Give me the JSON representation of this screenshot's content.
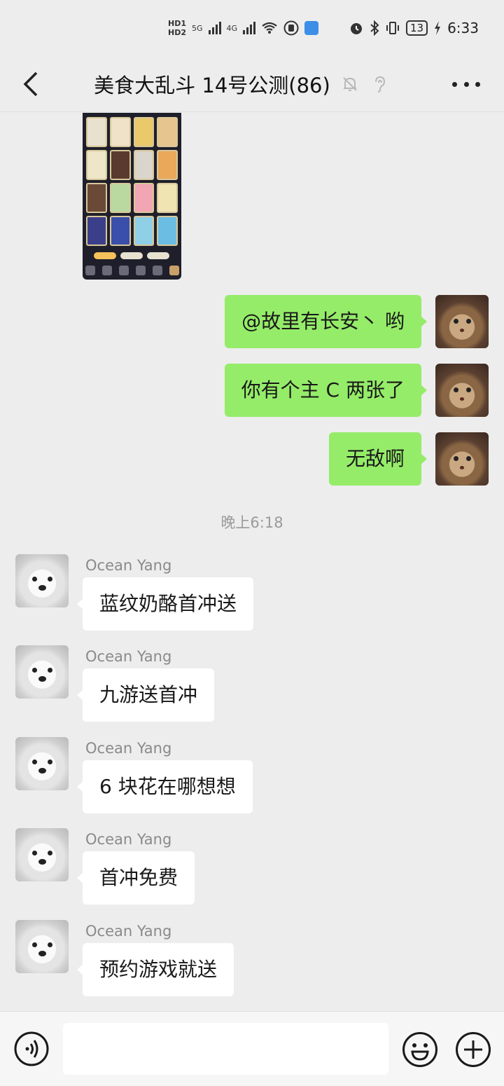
{
  "status_bar": {
    "hd1": "HD1",
    "hd2": "HD2",
    "net1": "5G",
    "net2": "4G",
    "battery": "13",
    "time": "6:33",
    "icons": [
      "wifi-icon",
      "hand-icon",
      "app-chip-icon",
      "alarm-icon",
      "bluetooth-icon",
      "vibrate-icon",
      "charging-icon"
    ]
  },
  "nav": {
    "title": "美食大乱斗 14号公测(86)",
    "icons": [
      "back-chevron-icon",
      "mute-bell-icon",
      "ear-icon",
      "more-dots-icon"
    ]
  },
  "messages": {
    "out": [
      {
        "text": "@故里有长安丶  哟"
      },
      {
        "text": "你有个主 C 两张了"
      },
      {
        "text": "无敌啊"
      }
    ],
    "time_separator": "晚上6:18",
    "in": [
      {
        "sender": "Ocean Yang",
        "text": "蓝纹奶酪首冲送"
      },
      {
        "sender": "Ocean Yang",
        "text": "九游送首冲"
      },
      {
        "sender": "Ocean Yang",
        "text": "6 块花在哪想想"
      },
      {
        "sender": "Ocean Yang",
        "text": "首冲免费"
      },
      {
        "sender": "Ocean Yang",
        "text": "预约游戏就送"
      }
    ]
  },
  "colors": {
    "background": "#ededed",
    "out_bubble": "#95ec69",
    "in_bubble": "#ffffff",
    "sender_name": "#8a8a8a"
  },
  "input_bar": {
    "icons": [
      "voice-icon",
      "emoji-icon",
      "plus-icon"
    ]
  }
}
